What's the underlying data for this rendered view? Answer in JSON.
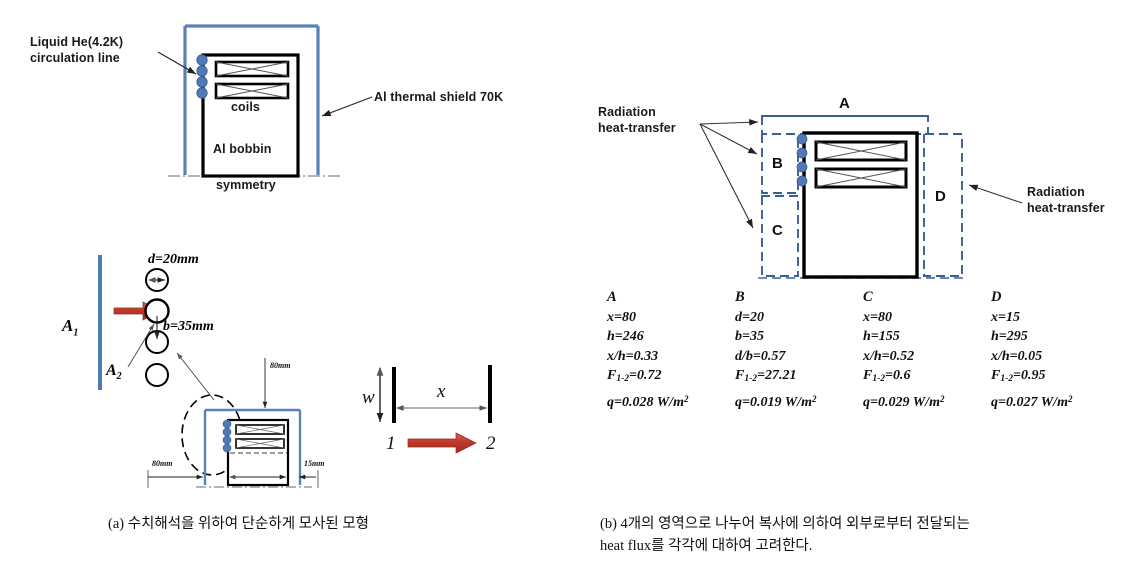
{
  "panel_a": {
    "labels": {
      "liquid_he_line1": "Liquid He(4.2K)",
      "liquid_he_line2": "circulation line",
      "shield": "Al thermal shield 70K",
      "coils": "coils",
      "bobbin": "Al bobbin",
      "symmetry": "symmetry"
    },
    "detail": {
      "d_label": "d=20mm",
      "b_label": "b=35mm",
      "a1": "A",
      "a1_sub": "1",
      "a2": "A",
      "a2_sub": "2",
      "dim_top": "80mm",
      "dim_left": "80mm",
      "dim_right": "15mm"
    },
    "viewfactor": {
      "w": "w",
      "x": "x",
      "surface_1": "1",
      "surface_2": "2"
    },
    "caption": "(a) 수치해석을 위하여 단순하게 모사된 모형"
  },
  "panel_b": {
    "labels": {
      "radiation_left_1": "Radiation",
      "radiation_left_2": "heat-transfer",
      "radiation_right_1": "Radiation",
      "radiation_right_2": "heat-transfer",
      "region_a": "A",
      "region_b": "B",
      "region_c": "C",
      "region_d": "D"
    },
    "columns": [
      {
        "name": "A",
        "rows": [
          {
            "sym": "x",
            "sub": "",
            "val": "=80"
          },
          {
            "sym": "h",
            "sub": "",
            "val": "=246"
          },
          {
            "sym": "x/h",
            "sub": "",
            "val": "=0.33"
          },
          {
            "sym": "F",
            "sub": "1-2",
            "val": "=0.72"
          },
          {
            "sym": "q",
            "sub": "",
            "val": "=0.028 W/m",
            "sup": "2"
          }
        ]
      },
      {
        "name": "B",
        "rows": [
          {
            "sym": "d",
            "sub": "",
            "val": "=20"
          },
          {
            "sym": "b",
            "sub": "",
            "val": "=35"
          },
          {
            "sym": "d/b",
            "sub": "",
            "val": "=0.57"
          },
          {
            "sym": "F",
            "sub": "1-2",
            "val": "=27.21"
          },
          {
            "sym": "q",
            "sub": "",
            "val": "=0.019 W/m",
            "sup": "2"
          }
        ]
      },
      {
        "name": "C",
        "rows": [
          {
            "sym": "x",
            "sub": "",
            "val": "=80"
          },
          {
            "sym": "h",
            "sub": "",
            "val": "=155"
          },
          {
            "sym": "x/h",
            "sub": "",
            "val": "=0.52"
          },
          {
            "sym": "F",
            "sub": "1-2",
            "val": "=0.6"
          },
          {
            "sym": "q",
            "sub": "",
            "val": "=0.029 W/m",
            "sup": "2"
          }
        ]
      },
      {
        "name": "D",
        "rows": [
          {
            "sym": "x",
            "sub": "",
            "val": "=15"
          },
          {
            "sym": "h",
            "sub": "",
            "val": "=295"
          },
          {
            "sym": "x/h",
            "sub": "",
            "val": "=0.05"
          },
          {
            "sym": "F",
            "sub": "1-2",
            "val": "=0.95"
          },
          {
            "sym": "q",
            "sub": "",
            "val": "=0.027 W/m",
            "sup": "2"
          }
        ]
      }
    ],
    "caption_line1": "(b) 4개의 영역으로 나누어 복사에 의하여 외부로부터 전달되는",
    "caption_line2": "heat flux를 각각에 대하여 고려한다."
  },
  "colors": {
    "shield_blue": "#5b80b8",
    "coil_circle": "#4f7ab5",
    "dashed_blue": "#3a5f96",
    "arrow_red": "#c0392b",
    "black": "#000000"
  }
}
